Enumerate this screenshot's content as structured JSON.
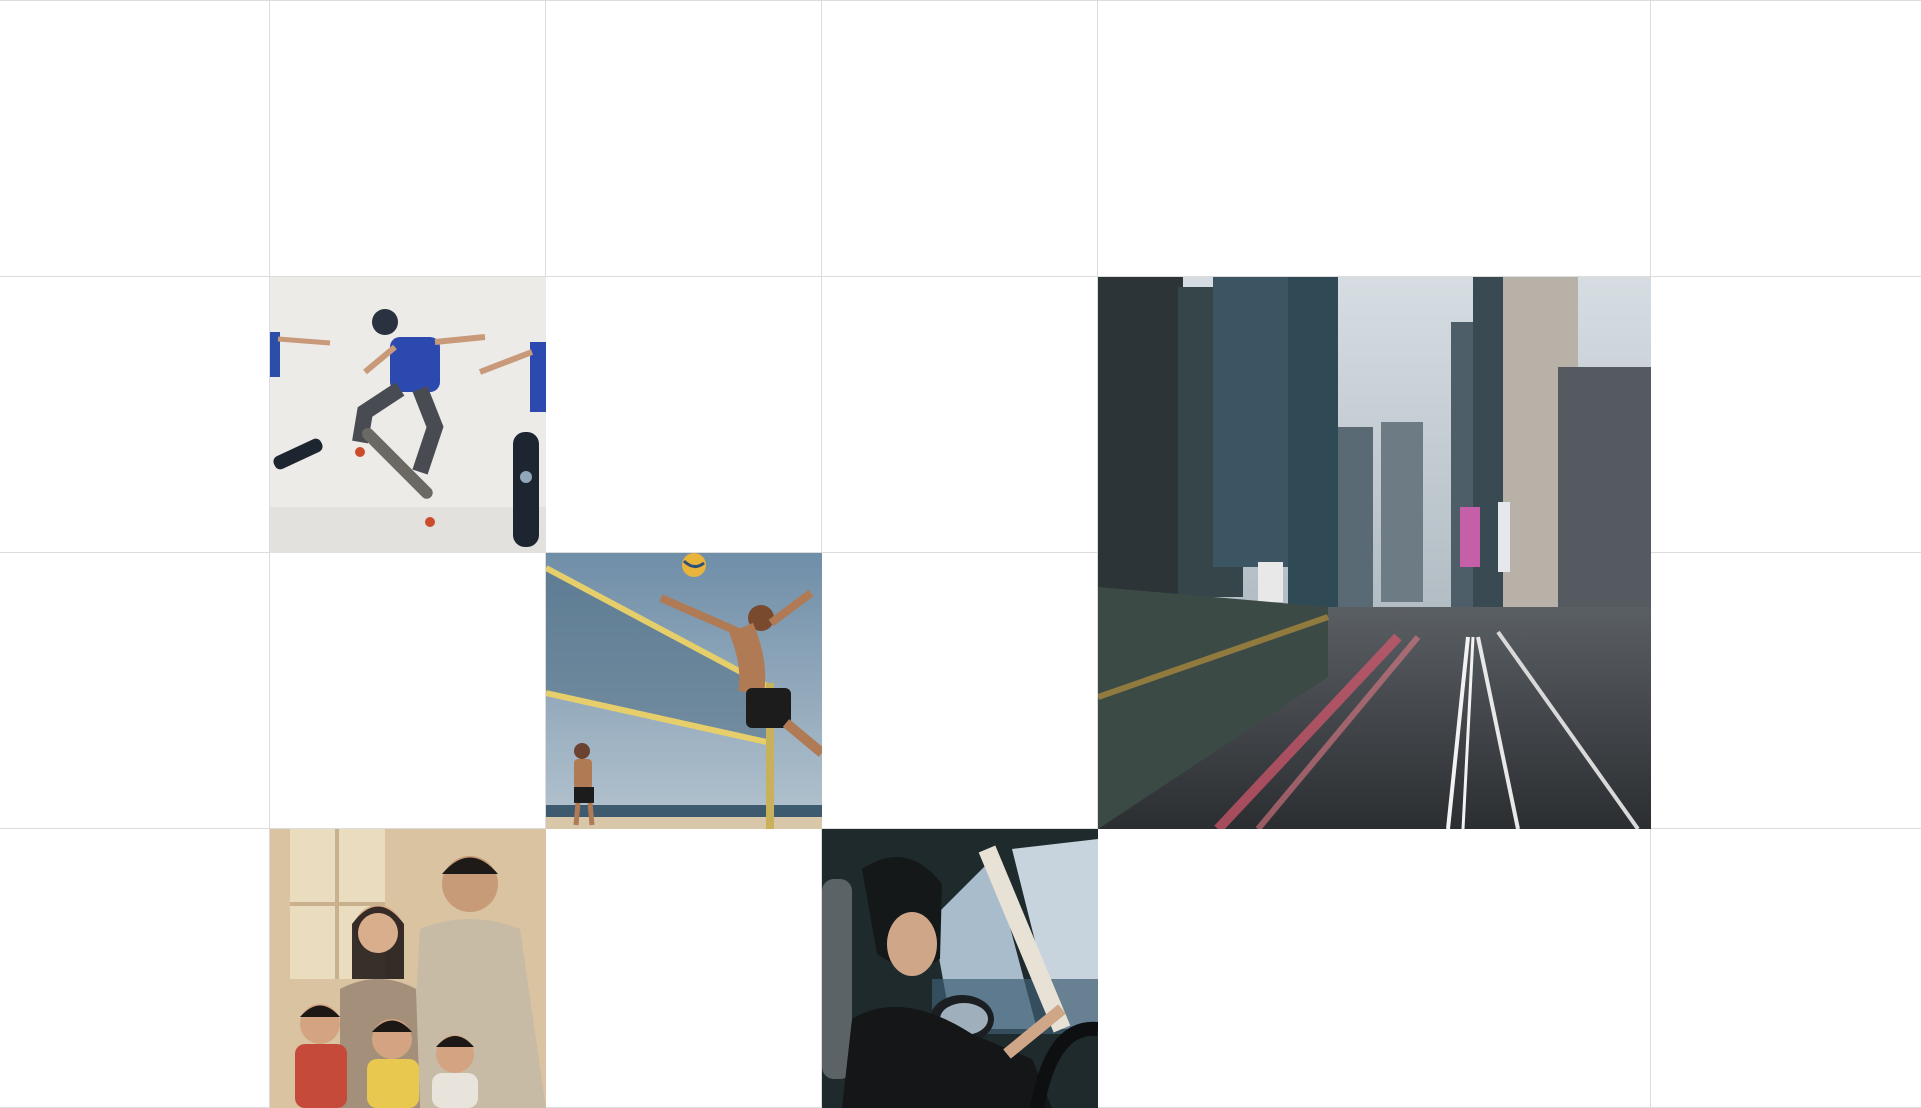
{
  "gallery": {
    "tiles": [
      {
        "id": "skateboarders",
        "icon": "skateboard-photo-icon"
      },
      {
        "id": "city-traffic",
        "icon": "city-photo-icon"
      },
      {
        "id": "beach-volleyball",
        "icon": "volleyball-photo-icon"
      },
      {
        "id": "family-portrait",
        "icon": "family-photo-icon"
      },
      {
        "id": "car-driver",
        "icon": "car-photo-icon"
      }
    ]
  },
  "colors": {
    "grid_line": "#dcdcdc",
    "background": "#ffffff"
  }
}
